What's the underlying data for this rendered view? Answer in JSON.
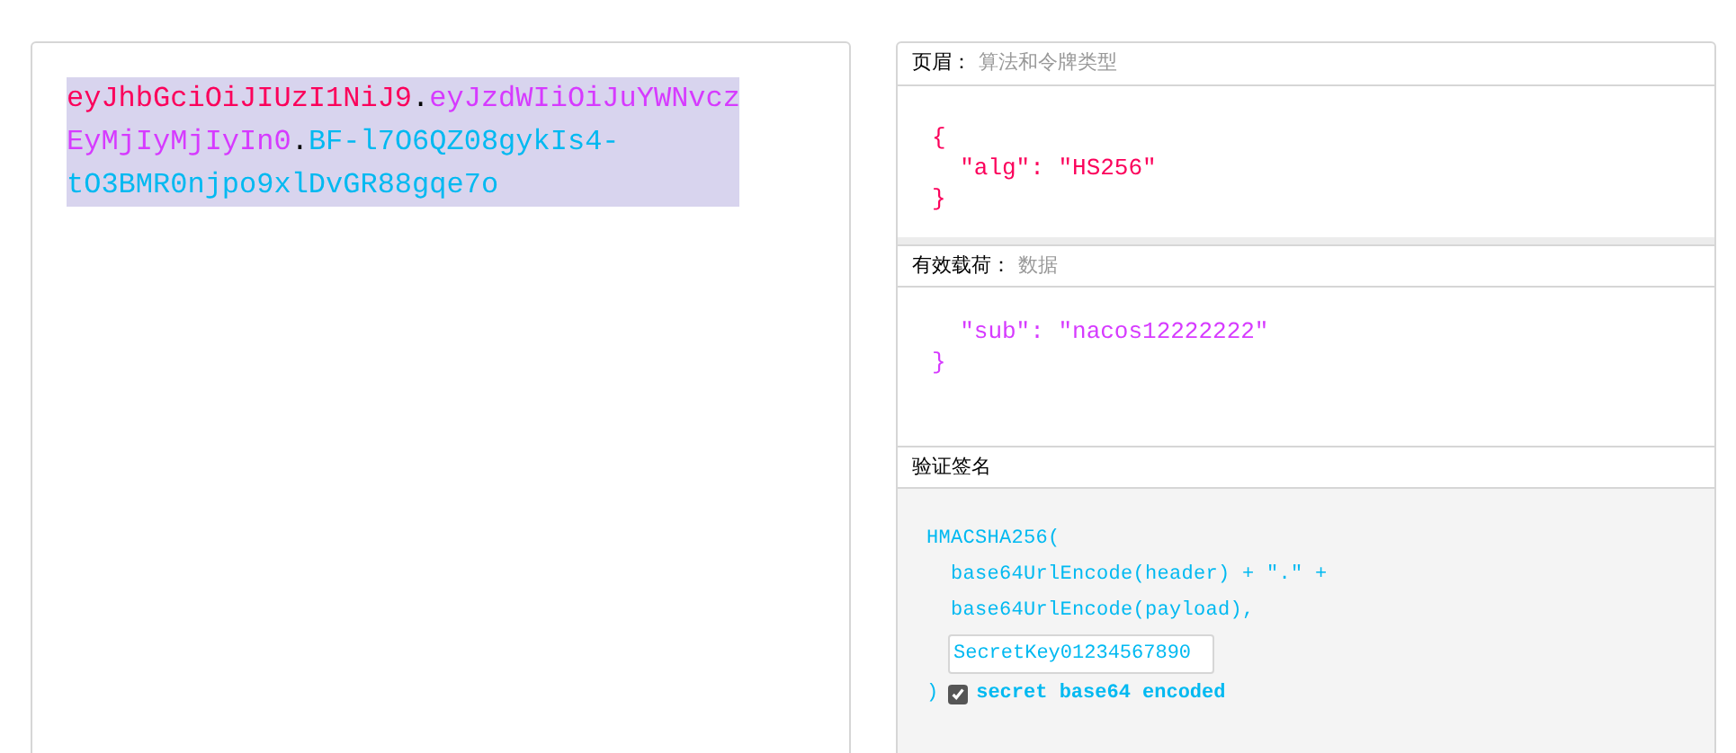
{
  "encoded": {
    "lines": [
      [
        {
          "text": "eyJhbGciOiJIUzI1NiJ9",
          "color": "#fb015b"
        },
        {
          "text": ".",
          "color": "#000000"
        },
        {
          "text": "eyJzdWIiOiJuYWNvcz",
          "color": "#d63aff"
        }
      ],
      [
        {
          "text": "EyMjIyMjIyIn0",
          "color": "#d63aff"
        },
        {
          "text": ".",
          "color": "#000000"
        },
        {
          "text": "BF-l7O6QZ08gykIs4-",
          "color": "#00b9f1"
        }
      ],
      [
        {
          "text": "tO3BMR0njpo9xlDvGR88gqe7o",
          "color": "#00b9f1"
        }
      ]
    ],
    "selected": true
  },
  "decoded": {
    "sections": [
      {
        "kind": "json",
        "title": "页眉：",
        "subtitle": "算法和令牌类型",
        "color": "#fb015b",
        "lines": [
          "{",
          "  \"alg\": \"HS256\"",
          "}"
        ]
      },
      {
        "kind": "json",
        "title": "有效载荷：",
        "subtitle": "数据",
        "color": "#d63aff",
        "lines": [
          "  \"sub\": \"nacos12222222\"",
          "}"
        ]
      },
      {
        "kind": "signature",
        "title": "验证签名",
        "color": "#00b9f1",
        "lines": [
          "HMACSHA256(",
          "  base64UrlEncode(header) + \".\" +",
          "  base64UrlEncode(payload),"
        ],
        "secret": "SecretKey01234567890",
        "close": ")",
        "checkbox": {
          "label": "secret base64 encoded",
          "checked": true
        }
      }
    ]
  }
}
